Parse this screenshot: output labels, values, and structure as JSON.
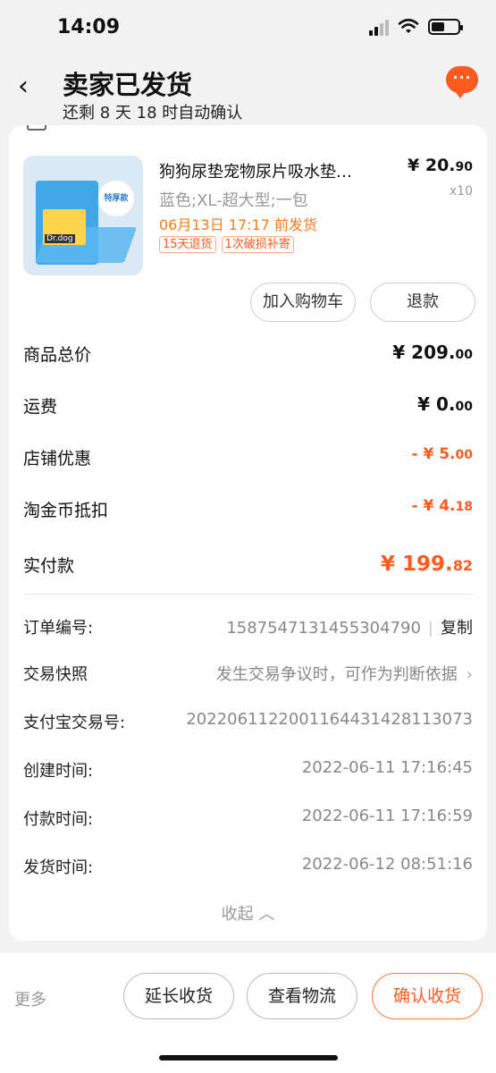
{
  "status_bar": {
    "time": "14:09"
  },
  "header": {
    "title": "卖家已发货",
    "subtitle": "还剩 8 天 18 时自动确认",
    "back_icon": "chevron-left-icon",
    "chat_icon": "chat-bubble-icon",
    "chat_glyph": "···"
  },
  "product": {
    "name": "狗狗尿垫宠物尿片吸水垫…",
    "price_int": "¥ 20.",
    "price_dec": "90",
    "qty": "x10",
    "spec": "蓝色;XL-超大型;一包",
    "ship_time": "06月13日 17:17 前发货",
    "tags": [
      "15天退货",
      "1次破损补寄"
    ],
    "image_badge": "特厚款",
    "image_brand": "Dr.dog"
  },
  "actions": {
    "add_to_cart": "加入购物车",
    "refund": "退款"
  },
  "summary": [
    {
      "label": "商品总价",
      "int": "¥ 209.",
      "dec": "00",
      "style": "normal"
    },
    {
      "label": "运费",
      "int": "¥ 0.",
      "dec": "00",
      "style": "normal"
    },
    {
      "label": "店铺优惠",
      "int": "- ¥ 5.",
      "dec": "00",
      "style": "neg"
    },
    {
      "label": "淘金币抵扣",
      "int": "- ¥ 4.",
      "dec": "18",
      "style": "neg"
    },
    {
      "label": "实付款",
      "int": "¥ 199.",
      "dec": "82",
      "style": "total"
    }
  ],
  "order_info": {
    "order_no_label": "订单编号:",
    "order_no": "1587547131455304790",
    "copy_label": "复制",
    "snapshot_label": "交易快照",
    "snapshot_value": "发生交易争议时，可作为判断依据",
    "alipay_label": "支付宝交易号:",
    "alipay_no": "2022061122001164431428113073",
    "created_label": "创建时间:",
    "created": "2022-06-11 17:16:45",
    "paid_label": "付款时间:",
    "paid": "2022-06-11 17:16:59",
    "shipped_label": "发货时间:",
    "shipped": "2022-06-12 08:51:16"
  },
  "collapse_label": "收起 ︿",
  "bottom": {
    "more": "更多",
    "extend": "延长收货",
    "logistics": "查看物流",
    "confirm": "确认收货"
  },
  "colors": {
    "accent": "#ff5a1f",
    "price_orange": "#ff7a1a"
  }
}
